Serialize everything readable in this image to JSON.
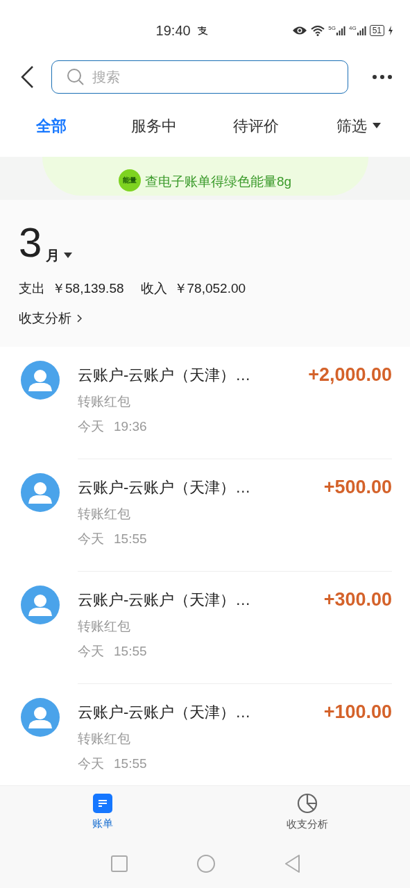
{
  "status_bar": {
    "time": "19:40",
    "network_1": "5G",
    "network_2": "4G",
    "battery": "51"
  },
  "search": {
    "placeholder": "搜索"
  },
  "tabs": [
    {
      "label": "全部",
      "selected": true
    },
    {
      "label": "服务中",
      "selected": false
    },
    {
      "label": "待评价",
      "selected": false
    },
    {
      "label": "筛选",
      "selected": false
    }
  ],
  "banner": {
    "badge": "能量",
    "text": "查电子账单得绿色能量8g"
  },
  "month": {
    "number": "3",
    "unit": "月"
  },
  "summary": {
    "expense_label": "支出",
    "expense": "￥58,139.58",
    "income_label": "收入",
    "income": "￥78,052.00",
    "analysis_link": "收支分析"
  },
  "transactions": [
    {
      "title": "云账户-云账户（天津）…",
      "amount": "+2,000.00",
      "category": "转账红包",
      "day": "今天",
      "time": "19:36"
    },
    {
      "title": "云账户-云账户（天津）…",
      "amount": "+500.00",
      "category": "转账红包",
      "day": "今天",
      "time": "15:55"
    },
    {
      "title": "云账户-云账户（天津）…",
      "amount": "+300.00",
      "category": "转账红包",
      "day": "今天",
      "time": "15:55"
    },
    {
      "title": "云账户-云账户（天津）…",
      "amount": "+100.00",
      "category": "转账红包",
      "day": "今天",
      "time": "15:55"
    }
  ],
  "bottom_nav": [
    {
      "label": "账单",
      "kind": "bill",
      "selected": true
    },
    {
      "label": "收支分析",
      "kind": "chart",
      "selected": false
    }
  ]
}
